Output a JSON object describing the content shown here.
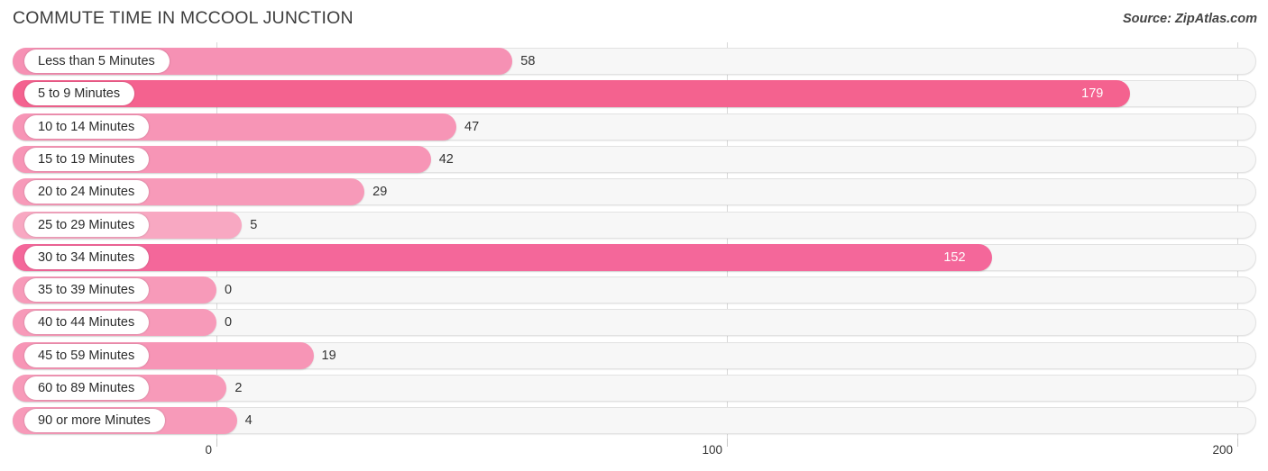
{
  "header": {
    "title": "COMMUTE TIME IN MCCOOL JUNCTION",
    "source": "Source: ZipAtlas.com"
  },
  "chart_data": {
    "type": "bar",
    "orientation": "horizontal",
    "title": "COMMUTE TIME IN MCCOOL JUNCTION",
    "xlabel": "",
    "ylabel": "",
    "xlim": [
      0,
      200
    ],
    "xticks": [
      0,
      100,
      200
    ],
    "xtick_labels": [
      "0",
      "100",
      "200"
    ],
    "grid": true,
    "legend": "none",
    "categories": [
      "Less than 5 Minutes",
      "5 to 9 Minutes",
      "10 to 14 Minutes",
      "15 to 19 Minutes",
      "20 to 24 Minutes",
      "25 to 29 Minutes",
      "30 to 34 Minutes",
      "35 to 39 Minutes",
      "40 to 44 Minutes",
      "45 to 59 Minutes",
      "60 to 89 Minutes",
      "90 or more Minutes"
    ],
    "values": [
      58,
      179,
      47,
      42,
      29,
      5,
      152,
      0,
      0,
      19,
      2,
      4
    ],
    "value_labels": [
      "58",
      "179",
      "47",
      "42",
      "29",
      "5",
      "152",
      "0",
      "0",
      "19",
      "2",
      "4"
    ],
    "bars": [
      {
        "label": "Less than 5 Minutes",
        "value": 58,
        "value_label": "58",
        "color": "#f691b4",
        "label_inside": false
      },
      {
        "label": "5 to 9 Minutes",
        "value": 179,
        "value_label": "179",
        "color": "#f4628f",
        "label_inside": true
      },
      {
        "label": "10 to 14 Minutes",
        "value": 47,
        "value_label": "47",
        "color": "#f795b6",
        "label_inside": false
      },
      {
        "label": "15 to 19 Minutes",
        "value": 42,
        "value_label": "42",
        "color": "#f795b6",
        "label_inside": false
      },
      {
        "label": "20 to 24 Minutes",
        "value": 29,
        "value_label": "29",
        "color": "#f79ab9",
        "label_inside": false
      },
      {
        "label": "25 to 29 Minutes",
        "value": 5,
        "value_label": "5",
        "color": "#f8a8c2",
        "label_inside": false
      },
      {
        "label": "30 to 34 Minutes",
        "value": 152,
        "value_label": "152",
        "color": "#f4679a",
        "label_inside": true
      },
      {
        "label": "35 to 39 Minutes",
        "value": 0,
        "value_label": "0",
        "color": "#f79ab9",
        "label_inside": false
      },
      {
        "label": "40 to 44 Minutes",
        "value": 0,
        "value_label": "0",
        "color": "#f79ab9",
        "label_inside": false
      },
      {
        "label": "45 to 59 Minutes",
        "value": 19,
        "value_label": "19",
        "color": "#f795b6",
        "label_inside": false
      },
      {
        "label": "60 to 89 Minutes",
        "value": 2,
        "value_label": "2",
        "color": "#f79ab9",
        "label_inside": false
      },
      {
        "label": "90 or more Minutes",
        "value": 4,
        "value_label": "4",
        "color": "#f79ab9",
        "label_inside": false
      }
    ]
  },
  "colors": {
    "bar_light": "#f8a8c2",
    "bar_mid": "#f795b6",
    "bar_strong": "#f4679a",
    "track": "#f7f7f7",
    "track_border": "#e2e2e2",
    "gridline": "#d8d8d8",
    "text": "#333333",
    "title": "#3c3c3c"
  }
}
